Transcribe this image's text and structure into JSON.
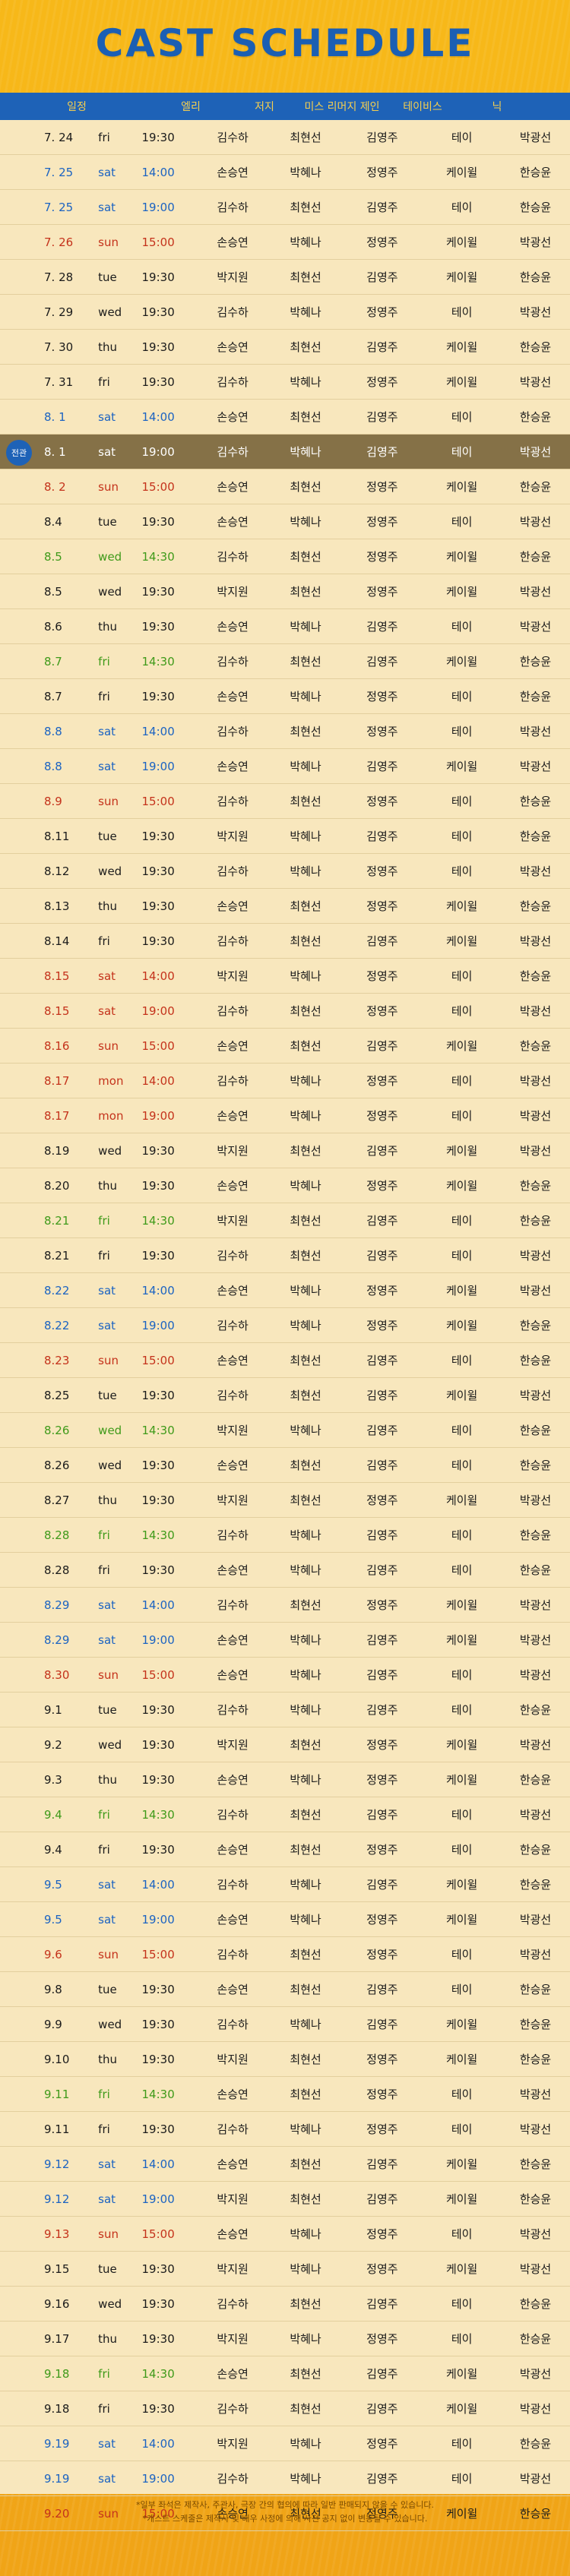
{
  "title": "CAST SCHEDULE",
  "headers": {
    "date": "일정",
    "c1": "엘리",
    "c2": "저지",
    "c3": "미스 리머지 제인",
    "c4": "테이비스",
    "c5": "닉"
  },
  "rows": [
    {
      "date": "7. 24",
      "day": "fri",
      "time": "19:30",
      "c": [
        "김수하",
        "최현선",
        "김영주",
        "테이",
        "박광선"
      ],
      "color": "dark"
    },
    {
      "date": "7. 25",
      "day": "sat",
      "time": "14:00",
      "c": [
        "손승연",
        "박혜나",
        "정영주",
        "케이윌",
        "한승윤"
      ],
      "color": "sat"
    },
    {
      "date": "7. 25",
      "day": "sat",
      "time": "19:00",
      "c": [
        "김수하",
        "최현선",
        "김영주",
        "테이",
        "한승윤"
      ],
      "color": "sat"
    },
    {
      "date": "7. 26",
      "day": "sun",
      "time": "15:00",
      "c": [
        "손승연",
        "박혜나",
        "정영주",
        "케이윌",
        "박광선"
      ],
      "color": "sun"
    },
    {
      "date": "7. 28",
      "day": "tue",
      "time": "19:30",
      "c": [
        "박지원",
        "최현선",
        "김영주",
        "케이윌",
        "한승윤"
      ],
      "color": "dark"
    },
    {
      "date": "7. 29",
      "day": "wed",
      "time": "19:30",
      "c": [
        "김수하",
        "박혜나",
        "정영주",
        "테이",
        "박광선"
      ],
      "color": "dark"
    },
    {
      "date": "7. 30",
      "day": "thu",
      "time": "19:30",
      "c": [
        "손승연",
        "최현선",
        "김영주",
        "케이윌",
        "한승윤"
      ],
      "color": "dark"
    },
    {
      "date": "7. 31",
      "day": "fri",
      "time": "19:30",
      "c": [
        "김수하",
        "박혜나",
        "정영주",
        "케이윌",
        "박광선"
      ],
      "color": "dark"
    },
    {
      "date": "8. 1",
      "day": "sat",
      "time": "14:00",
      "c": [
        "손승연",
        "최현선",
        "김영주",
        "테이",
        "한승윤"
      ],
      "color": "sat"
    },
    {
      "date": "8. 1",
      "day": "sat",
      "time": "19:00",
      "c": [
        "김수하",
        "박혜나",
        "김영주",
        "테이",
        "박광선"
      ],
      "color": "highlight",
      "badge": "전관"
    },
    {
      "date": "8. 2",
      "day": "sun",
      "time": "15:00",
      "c": [
        "손승연",
        "최현선",
        "정영주",
        "케이윌",
        "한승윤"
      ],
      "color": "sun"
    },
    {
      "date": "8.4",
      "day": "tue",
      "time": "19:30",
      "c": [
        "손승연",
        "박혜나",
        "정영주",
        "테이",
        "박광선"
      ],
      "color": "dark"
    },
    {
      "date": "8.5",
      "day": "wed",
      "time": "14:30",
      "c": [
        "김수하",
        "최현선",
        "정영주",
        "케이윌",
        "한승윤"
      ],
      "color": "green"
    },
    {
      "date": "8.5",
      "day": "wed",
      "time": "19:30",
      "c": [
        "박지원",
        "최현선",
        "정영주",
        "케이윌",
        "박광선"
      ],
      "color": "dark"
    },
    {
      "date": "8.6",
      "day": "thu",
      "time": "19:30",
      "c": [
        "손승연",
        "박혜나",
        "김영주",
        "테이",
        "박광선"
      ],
      "color": "dark"
    },
    {
      "date": "8.7",
      "day": "fri",
      "time": "14:30",
      "c": [
        "김수하",
        "최현선",
        "김영주",
        "케이윌",
        "한승윤"
      ],
      "color": "green"
    },
    {
      "date": "8.7",
      "day": "fri",
      "time": "19:30",
      "c": [
        "손승연",
        "박혜나",
        "정영주",
        "테이",
        "한승윤"
      ],
      "color": "dark"
    },
    {
      "date": "8.8",
      "day": "sat",
      "time": "14:00",
      "c": [
        "김수하",
        "최현선",
        "정영주",
        "테이",
        "박광선"
      ],
      "color": "sat"
    },
    {
      "date": "8.8",
      "day": "sat",
      "time": "19:00",
      "c": [
        "손승연",
        "박혜나",
        "김영주",
        "케이윌",
        "박광선"
      ],
      "color": "sat"
    },
    {
      "date": "8.9",
      "day": "sun",
      "time": "15:00",
      "c": [
        "김수하",
        "최현선",
        "정영주",
        "테이",
        "한승윤"
      ],
      "color": "sun"
    },
    {
      "date": "8.11",
      "day": "tue",
      "time": "19:30",
      "c": [
        "박지원",
        "박혜나",
        "김영주",
        "테이",
        "한승윤"
      ],
      "color": "dark"
    },
    {
      "date": "8.12",
      "day": "wed",
      "time": "19:30",
      "c": [
        "김수하",
        "박혜나",
        "정영주",
        "테이",
        "박광선"
      ],
      "color": "dark"
    },
    {
      "date": "8.13",
      "day": "thu",
      "time": "19:30",
      "c": [
        "손승연",
        "최현선",
        "정영주",
        "케이윌",
        "한승윤"
      ],
      "color": "dark"
    },
    {
      "date": "8.14",
      "day": "fri",
      "time": "19:30",
      "c": [
        "김수하",
        "최현선",
        "김영주",
        "케이윌",
        "박광선"
      ],
      "color": "dark"
    },
    {
      "date": "8.15",
      "day": "sat",
      "time": "14:00",
      "c": [
        "박지원",
        "박혜나",
        "정영주",
        "테이",
        "한승윤"
      ],
      "color": "sun"
    },
    {
      "date": "8.15",
      "day": "sat",
      "time": "19:00",
      "c": [
        "김수하",
        "최현선",
        "정영주",
        "테이",
        "박광선"
      ],
      "color": "sun"
    },
    {
      "date": "8.16",
      "day": "sun",
      "time": "15:00",
      "c": [
        "손승연",
        "최현선",
        "김영주",
        "케이윌",
        "한승윤"
      ],
      "color": "sun"
    },
    {
      "date": "8.17",
      "day": "mon",
      "time": "14:00",
      "c": [
        "김수하",
        "박혜나",
        "정영주",
        "테이",
        "박광선"
      ],
      "color": "sun"
    },
    {
      "date": "8.17",
      "day": "mon",
      "time": "19:00",
      "c": [
        "손승연",
        "박혜나",
        "정영주",
        "테이",
        "박광선"
      ],
      "color": "sun"
    },
    {
      "date": "8.19",
      "day": "wed",
      "time": "19:30",
      "c": [
        "박지원",
        "최현선",
        "김영주",
        "케이윌",
        "박광선"
      ],
      "color": "dark"
    },
    {
      "date": "8.20",
      "day": "thu",
      "time": "19:30",
      "c": [
        "손승연",
        "박혜나",
        "정영주",
        "케이윌",
        "한승윤"
      ],
      "color": "dark"
    },
    {
      "date": "8.21",
      "day": "fri",
      "time": "14:30",
      "c": [
        "박지원",
        "최현선",
        "김영주",
        "테이",
        "한승윤"
      ],
      "color": "green"
    },
    {
      "date": "8.21",
      "day": "fri",
      "time": "19:30",
      "c": [
        "김수하",
        "최현선",
        "김영주",
        "테이",
        "박광선"
      ],
      "color": "dark"
    },
    {
      "date": "8.22",
      "day": "sat",
      "time": "14:00",
      "c": [
        "손승연",
        "박혜나",
        "정영주",
        "케이윌",
        "박광선"
      ],
      "color": "sat"
    },
    {
      "date": "8.22",
      "day": "sat",
      "time": "19:00",
      "c": [
        "김수하",
        "박혜나",
        "정영주",
        "케이윌",
        "한승윤"
      ],
      "color": "sat"
    },
    {
      "date": "8.23",
      "day": "sun",
      "time": "15:00",
      "c": [
        "손승연",
        "최현선",
        "김영주",
        "테이",
        "한승윤"
      ],
      "color": "sun"
    },
    {
      "date": "8.25",
      "day": "tue",
      "time": "19:30",
      "c": [
        "김수하",
        "최현선",
        "김영주",
        "케이윌",
        "박광선"
      ],
      "color": "dark"
    },
    {
      "date": "8.26",
      "day": "wed",
      "time": "14:30",
      "c": [
        "박지원",
        "박혜나",
        "김영주",
        "테이",
        "한승윤"
      ],
      "color": "green"
    },
    {
      "date": "8.26",
      "day": "wed",
      "time": "19:30",
      "c": [
        "손승연",
        "최현선",
        "김영주",
        "테이",
        "한승윤"
      ],
      "color": "dark"
    },
    {
      "date": "8.27",
      "day": "thu",
      "time": "19:30",
      "c": [
        "박지원",
        "최현선",
        "정영주",
        "케이윌",
        "박광선"
      ],
      "color": "dark"
    },
    {
      "date": "8.28",
      "day": "fri",
      "time": "14:30",
      "c": [
        "김수하",
        "박혜나",
        "김영주",
        "테이",
        "한승윤"
      ],
      "color": "green"
    },
    {
      "date": "8.28",
      "day": "fri",
      "time": "19:30",
      "c": [
        "손승연",
        "박혜나",
        "김영주",
        "테이",
        "한승윤"
      ],
      "color": "dark"
    },
    {
      "date": "8.29",
      "day": "sat",
      "time": "14:00",
      "c": [
        "김수하",
        "최현선",
        "정영주",
        "케이윌",
        "박광선"
      ],
      "color": "sat"
    },
    {
      "date": "8.29",
      "day": "sat",
      "time": "19:00",
      "c": [
        "손승연",
        "박혜나",
        "김영주",
        "케이윌",
        "박광선"
      ],
      "color": "sat"
    },
    {
      "date": "8.30",
      "day": "sun",
      "time": "15:00",
      "c": [
        "손승연",
        "박혜나",
        "김영주",
        "테이",
        "박광선"
      ],
      "color": "sun"
    },
    {
      "date": "9.1",
      "day": "tue",
      "time": "19:30",
      "c": [
        "김수하",
        "박혜나",
        "김영주",
        "테이",
        "한승윤"
      ],
      "color": "dark"
    },
    {
      "date": "9.2",
      "day": "wed",
      "time": "19:30",
      "c": [
        "박지원",
        "최현선",
        "정영주",
        "케이윌",
        "박광선"
      ],
      "color": "dark"
    },
    {
      "date": "9.3",
      "day": "thu",
      "time": "19:30",
      "c": [
        "손승연",
        "박혜나",
        "정영주",
        "케이윌",
        "한승윤"
      ],
      "color": "dark"
    },
    {
      "date": "9.4",
      "day": "fri",
      "time": "14:30",
      "c": [
        "김수하",
        "최현선",
        "김영주",
        "테이",
        "박광선"
      ],
      "color": "green"
    },
    {
      "date": "9.4",
      "day": "fri",
      "time": "19:30",
      "c": [
        "손승연",
        "최현선",
        "정영주",
        "테이",
        "한승윤"
      ],
      "color": "dark"
    },
    {
      "date": "9.5",
      "day": "sat",
      "time": "14:00",
      "c": [
        "김수하",
        "박혜나",
        "김영주",
        "케이윌",
        "한승윤"
      ],
      "color": "sat"
    },
    {
      "date": "9.5",
      "day": "sat",
      "time": "19:00",
      "c": [
        "손승연",
        "박혜나",
        "정영주",
        "케이윌",
        "박광선"
      ],
      "color": "sat"
    },
    {
      "date": "9.6",
      "day": "sun",
      "time": "15:00",
      "c": [
        "김수하",
        "최현선",
        "정영주",
        "테이",
        "박광선"
      ],
      "color": "sun"
    },
    {
      "date": "9.8",
      "day": "tue",
      "time": "19:30",
      "c": [
        "손승연",
        "최현선",
        "김영주",
        "테이",
        "한승윤"
      ],
      "color": "dark"
    },
    {
      "date": "9.9",
      "day": "wed",
      "time": "19:30",
      "c": [
        "김수하",
        "박혜나",
        "김영주",
        "케이윌",
        "한승윤"
      ],
      "color": "dark"
    },
    {
      "date": "9.10",
      "day": "thu",
      "time": "19:30",
      "c": [
        "박지원",
        "최현선",
        "정영주",
        "케이윌",
        "한승윤"
      ],
      "color": "dark"
    },
    {
      "date": "9.11",
      "day": "fri",
      "time": "14:30",
      "c": [
        "손승연",
        "최현선",
        "정영주",
        "테이",
        "박광선"
      ],
      "color": "green"
    },
    {
      "date": "9.11",
      "day": "fri",
      "time": "19:30",
      "c": [
        "김수하",
        "박혜나",
        "정영주",
        "테이",
        "박광선"
      ],
      "color": "dark"
    },
    {
      "date": "9.12",
      "day": "sat",
      "time": "14:00",
      "c": [
        "손승연",
        "최현선",
        "김영주",
        "케이윌",
        "한승윤"
      ],
      "color": "sat"
    },
    {
      "date": "9.12",
      "day": "sat",
      "time": "19:00",
      "c": [
        "박지원",
        "최현선",
        "김영주",
        "케이윌",
        "한승윤"
      ],
      "color": "sat"
    },
    {
      "date": "9.13",
      "day": "sun",
      "time": "15:00",
      "c": [
        "손승연",
        "박혜나",
        "정영주",
        "테이",
        "박광선"
      ],
      "color": "sun"
    },
    {
      "date": "9.15",
      "day": "tue",
      "time": "19:30",
      "c": [
        "박지원",
        "박혜나",
        "정영주",
        "케이윌",
        "박광선"
      ],
      "color": "dark"
    },
    {
      "date": "9.16",
      "day": "wed",
      "time": "19:30",
      "c": [
        "김수하",
        "최현선",
        "김영주",
        "테이",
        "한승윤"
      ],
      "color": "dark"
    },
    {
      "date": "9.17",
      "day": "thu",
      "time": "19:30",
      "c": [
        "박지원",
        "박혜나",
        "정영주",
        "테이",
        "한승윤"
      ],
      "color": "dark"
    },
    {
      "date": "9.18",
      "day": "fri",
      "time": "14:30",
      "c": [
        "손승연",
        "최현선",
        "김영주",
        "케이윌",
        "박광선"
      ],
      "color": "green"
    },
    {
      "date": "9.18",
      "day": "fri",
      "time": "19:30",
      "c": [
        "김수하",
        "최현선",
        "김영주",
        "케이윌",
        "박광선"
      ],
      "color": "dark"
    },
    {
      "date": "9.19",
      "day": "sat",
      "time": "14:00",
      "c": [
        "박지원",
        "박혜나",
        "정영주",
        "테이",
        "한승윤"
      ],
      "color": "sat"
    },
    {
      "date": "9.19",
      "day": "sat",
      "time": "19:00",
      "c": [
        "김수하",
        "박혜나",
        "김영주",
        "테이",
        "박광선"
      ],
      "color": "sat"
    },
    {
      "date": "9.20",
      "day": "sun",
      "time": "15:00",
      "c": [
        "손승연",
        "최현선",
        "정영주",
        "케이윌",
        "한승윤"
      ],
      "color": "sun"
    }
  ],
  "notes": [
    "*일부 좌석은 제작사, 주관사, 극장 간의 협의에 따라 일반 판매되지 않을 수 있습니다.",
    "*캐스트 스케줄은 제작사 및 배우 사정에 의해 사전 공지 없이 변동될 수 있습니다."
  ],
  "colors": {
    "sat": "#1b63c2",
    "sun": "#c4321b",
    "green": "#3f9a1a",
    "header": "#1e62b7",
    "title": "#1b5fb3"
  }
}
